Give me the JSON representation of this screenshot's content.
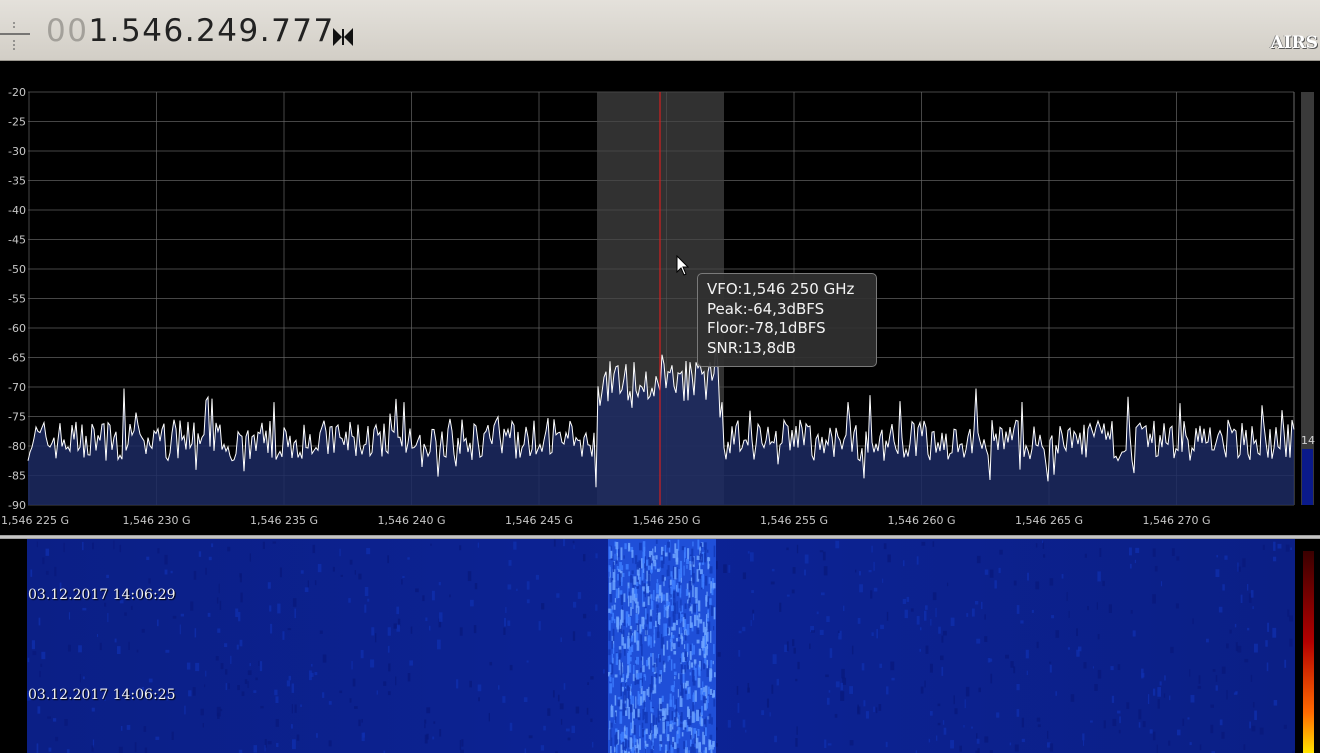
{
  "toolbar": {
    "frequency_leading": "00",
    "frequency_value": "1.546.249.777",
    "logo_text": "AIRS"
  },
  "spectrum": {
    "y_axis_labels": [
      "-20",
      "-25",
      "-30",
      "-35",
      "-40",
      "-45",
      "-50",
      "-55",
      "-60",
      "-65",
      "-70",
      "-75",
      "-80",
      "-85",
      "-90"
    ],
    "x_axis_labels": [
      "1,546 225 G",
      "1,546 230 G",
      "1,546 235 G",
      "1,546 240 G",
      "1,546 245 G",
      "1,546 250 G",
      "1,546 255 G",
      "1,546 260 G",
      "1,546 265 G",
      "1,546 270 G"
    ],
    "level_meter_value": "14",
    "noise_floor_db": -79,
    "signal_level_db": -69
  },
  "tooltip": {
    "vfo": "VFO:1,546 250 GHz",
    "peak": "Peak:-64,3dBFS",
    "floor": "Floor:-78,1dBFS",
    "snr": "SNR:13,8dB"
  },
  "waterfall": {
    "timestamps": [
      "03.12.2017 14:06:29",
      "03.12.2017 14:06:25"
    ]
  },
  "colors": {
    "signal_trace": "#ffffff",
    "vfo_line": "#d22020",
    "filter_band": "#3a3a3a",
    "waterfall_background": "#0b1f86",
    "waterfall_signal": "#3d7cff"
  },
  "icons": {
    "menu": "menu-grip-icon",
    "tune": "bowtie-tune-icon",
    "cursor": "mouse-pointer-icon"
  }
}
